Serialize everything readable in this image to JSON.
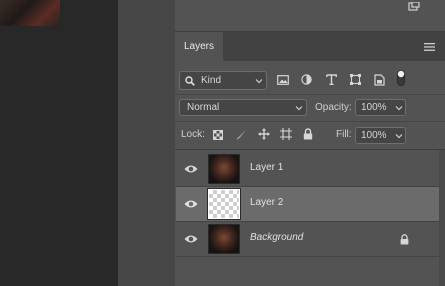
{
  "layers_panel": {
    "tab_label": "Layers",
    "filter": {
      "kind_label": "Kind"
    },
    "blend_mode": "Normal",
    "opacity_label": "Opacity:",
    "opacity_value": "100%",
    "lock_label": "Lock:",
    "fill_label": "Fill:",
    "fill_value": "100%",
    "layers": [
      {
        "name": "Layer 1",
        "thumbnail": "photo",
        "visible": true,
        "selected": false,
        "locked": false
      },
      {
        "name": "Layer 2",
        "thumbnail": "transparent",
        "visible": true,
        "selected": true,
        "locked": false
      },
      {
        "name": "Background",
        "thumbnail": "photo",
        "visible": true,
        "selected": false,
        "locked": true
      }
    ]
  },
  "colors": {
    "panel_bg": "#535353",
    "selected_row": "#6b6b6b",
    "tab_bar": "#424242",
    "canvas_bg": "#282828"
  },
  "icons": [
    "search-icon",
    "chevron-down-icon",
    "image-filter-icon",
    "adjustment-filter-icon",
    "type-filter-icon",
    "shape-filter-icon",
    "smart-object-filter-icon",
    "filter-toggle-icon",
    "panel-menu-icon",
    "lock-transparent-icon",
    "lock-image-icon",
    "lock-position-icon",
    "artboard-icon",
    "lock-all-icon",
    "eye-icon",
    "lock-icon"
  ]
}
